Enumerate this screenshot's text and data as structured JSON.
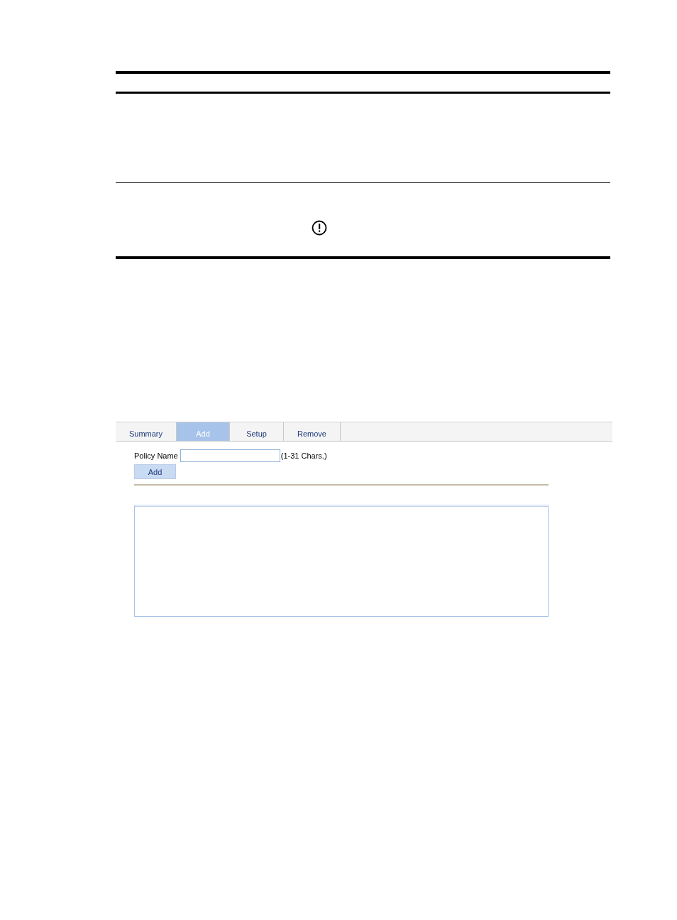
{
  "tabs": [
    {
      "label": "Summary",
      "selected": false
    },
    {
      "label": "Add",
      "selected": true
    },
    {
      "label": "Setup",
      "selected": false
    },
    {
      "label": "Remove",
      "selected": false
    }
  ],
  "form": {
    "label": "Policy Name",
    "hint": "(1-31 Chars.)",
    "button": "Add"
  }
}
